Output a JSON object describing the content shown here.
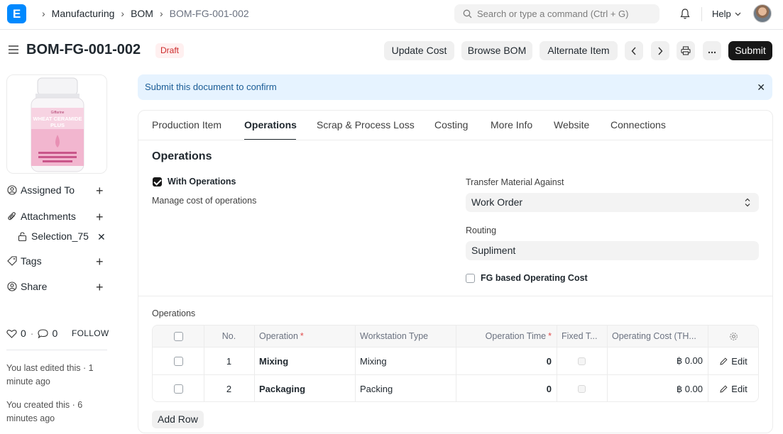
{
  "navbar": {
    "logo_letter": "E",
    "breadcrumbs": [
      "Manufacturing",
      "BOM",
      "BOM-FG-001-002"
    ],
    "search_placeholder": "Search or type a command (Ctrl + G)",
    "help_label": "Help"
  },
  "page": {
    "title": "BOM-FG-001-002",
    "status": "Draft",
    "actions": {
      "update_cost": "Update Cost",
      "browse_bom": "Browse BOM",
      "alternate_item": "Alternate Item",
      "submit": "Submit"
    }
  },
  "sidebar": {
    "assigned_to": "Assigned To",
    "attachments": "Attachments",
    "attachment_file": "Selection_75",
    "tags": "Tags",
    "share": "Share",
    "likes_count": "0",
    "comments_count": "0",
    "follow": "FOLLOW",
    "last_edited": "You last edited this · 1 minute ago",
    "created": "You created this · 6 minutes ago",
    "product_image_text": [
      "Giffarine",
      "WHEAT CERAMIDE",
      "PLUS"
    ]
  },
  "alert": {
    "message": "Submit this document to confirm"
  },
  "tabs": [
    "Production Item",
    "Operations",
    "Scrap & Process Loss",
    "Costing",
    "More Info",
    "Website",
    "Connections"
  ],
  "active_tab": "Operations",
  "form": {
    "section_title": "Operations",
    "with_operations_label": "With Operations",
    "with_operations_checked": true,
    "with_operations_description": "Manage cost of operations",
    "transfer_label": "Transfer Material Against",
    "transfer_value": "Work Order",
    "routing_label": "Routing",
    "routing_value": "Supliment",
    "fg_based_label": "FG based Operating Cost",
    "fg_based_checked": false
  },
  "operations_table": {
    "label": "Operations",
    "columns": [
      "No.",
      "Operation",
      "Workstation Type",
      "Operation Time",
      "Fixed T...",
      "Operating Cost (TH..."
    ],
    "required_marker": "*",
    "rows": [
      {
        "no": "1",
        "operation": "Mixing",
        "workstation_type": "Mixing",
        "time": "0",
        "cost": "฿ 0.00",
        "edit": "Edit"
      },
      {
        "no": "2",
        "operation": "Packaging",
        "workstation_type": "Packing",
        "time": "0",
        "cost": "฿ 0.00",
        "edit": "Edit"
      }
    ],
    "add_row": "Add Row"
  }
}
